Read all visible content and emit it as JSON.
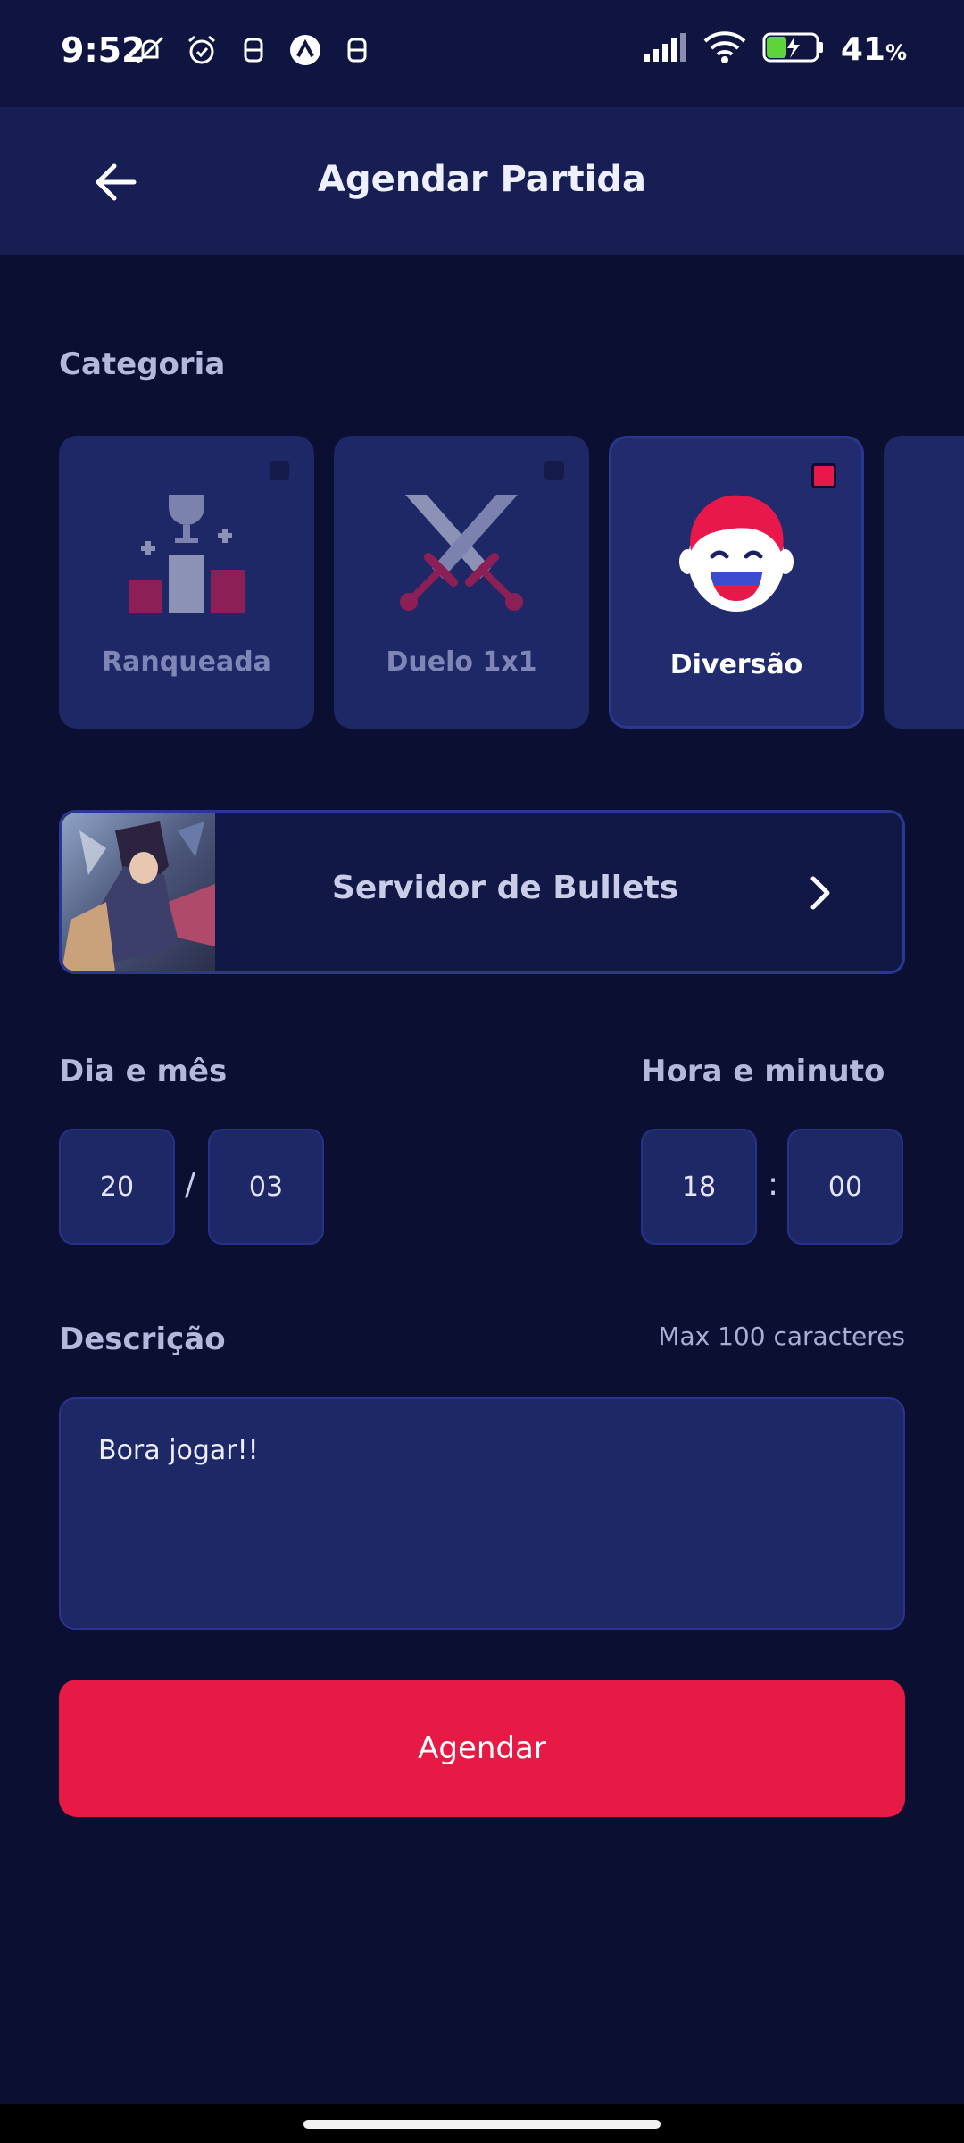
{
  "status_bar": {
    "time": "9:52",
    "battery_percent": "41",
    "battery_unit": "%",
    "icons": [
      "mute-icon",
      "alarm-icon",
      "notification-icon",
      "app-icon",
      "notification-icon",
      "signal-icon",
      "wifi-icon",
      "battery-charging-icon"
    ]
  },
  "header": {
    "title": "Agendar Partida",
    "back_icon": "arrow-left-icon"
  },
  "categoria": {
    "label": "Categoria",
    "items": [
      {
        "label": "Ranqueada",
        "icon": "trophy-podium-icon",
        "selected": false
      },
      {
        "label": "Duelo 1x1",
        "icon": "crossed-swords-icon",
        "selected": false
      },
      {
        "label": "Diversão",
        "icon": "laughing-face-icon",
        "selected": true
      }
    ]
  },
  "server": {
    "name": "Servidor de Bullets",
    "thumbnail_icon": "server-thumbnail",
    "chevron_icon": "chevron-right-icon"
  },
  "date": {
    "label": "Dia e mês",
    "day": "20",
    "separator": "/",
    "month": "03"
  },
  "time": {
    "label": "Hora e minuto",
    "hour": "18",
    "separator": ":",
    "minute": "00"
  },
  "description": {
    "label": "Descrição",
    "limit_text": "Max 100 caracteres",
    "value": "Bora jogar!!"
  },
  "submit": {
    "label": "Agendar"
  },
  "colors": {
    "background": "#0b1033",
    "card": "#1e2867",
    "accent": "#e61a45"
  }
}
